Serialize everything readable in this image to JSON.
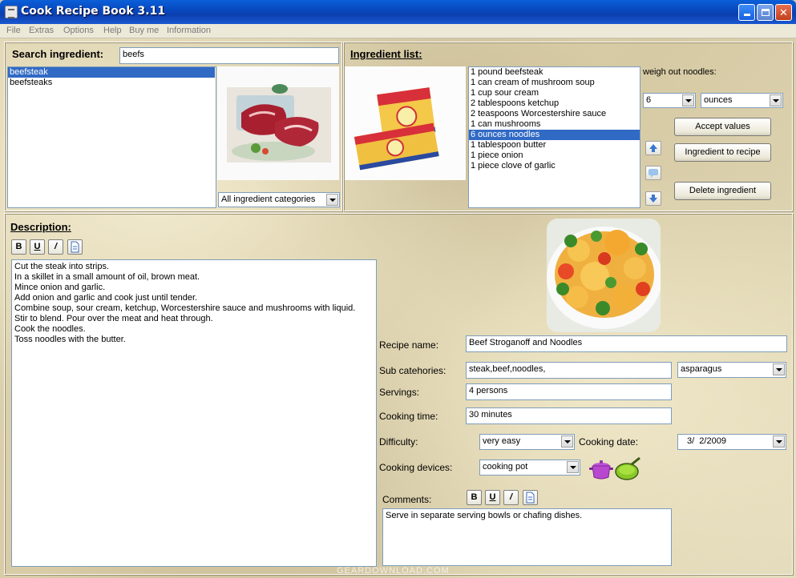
{
  "window": {
    "title": "Cook Recipe Book 3.11"
  },
  "menu": [
    "File",
    "Extras",
    "Options",
    "Help",
    "Buy me",
    "Information"
  ],
  "search": {
    "label": "Search ingredient:",
    "value": "beefs",
    "results": [
      "beefsteak",
      "beefsteaks"
    ],
    "category": "All ingredient categories"
  },
  "ingredients": {
    "label": "Ingredient list:",
    "items": [
      "1 pound beefsteak",
      "1 can cream of mushroom soup",
      "1 cup sour cream",
      "2 tablespoons ketchup",
      "2 teaspoons Worcestershire sauce",
      "1 can mushrooms",
      "6 ounces noodles",
      "1 tablespoon butter",
      "1 piece onion",
      "1 piece clove of garlic"
    ],
    "weigh_label": "weigh out noodles:",
    "amount": "6",
    "unit": "ounces",
    "accept_label": "Accept values",
    "to_recipe_label": "Ingredient to recipe",
    "delete_label": "Delete ingredient"
  },
  "description": {
    "label": "Description:",
    "format": {
      "bold": "B",
      "underline": "U",
      "italic": "/"
    },
    "lines": [
      "Cut the steak into strips.",
      "In a skillet in a small amount of oil, brown meat.",
      "Mince onion and garlic.",
      "Add onion and garlic and cook just until tender.",
      "Combine soup, sour cream, ketchup, Worcestershire sauce and mushrooms with liquid.",
      "Stir to blend. Pour over the meat and heat through.",
      "Cook the noodles.",
      "Toss noodles with the butter."
    ]
  },
  "recipe": {
    "name_label": "Recipe name:",
    "name": "Beef Stroganoff and Noodles",
    "sub_label": "Sub catehories:",
    "sub": "steak,beef,noodles,",
    "sub_combo": "asparagus",
    "servings_label": "Servings:",
    "servings": "4 persons",
    "time_label": "Cooking time:",
    "time": "30 minutes",
    "difficulty_label": "Difficulty:",
    "difficulty": "very easy",
    "date_label": "Cooking date:",
    "date": "3/  2/2009",
    "devices_label": "Cooking devices:",
    "device": "cooking pot",
    "comments_label": "Comments:",
    "comments": "Serve in separate serving bowls or chafing dishes."
  },
  "watermark": "GEARDOWNLOAD.COM",
  "colors": {
    "selection": "#316ac5",
    "titlebar": "#0b4ac2",
    "panel_bg": "#d8cfb0"
  }
}
